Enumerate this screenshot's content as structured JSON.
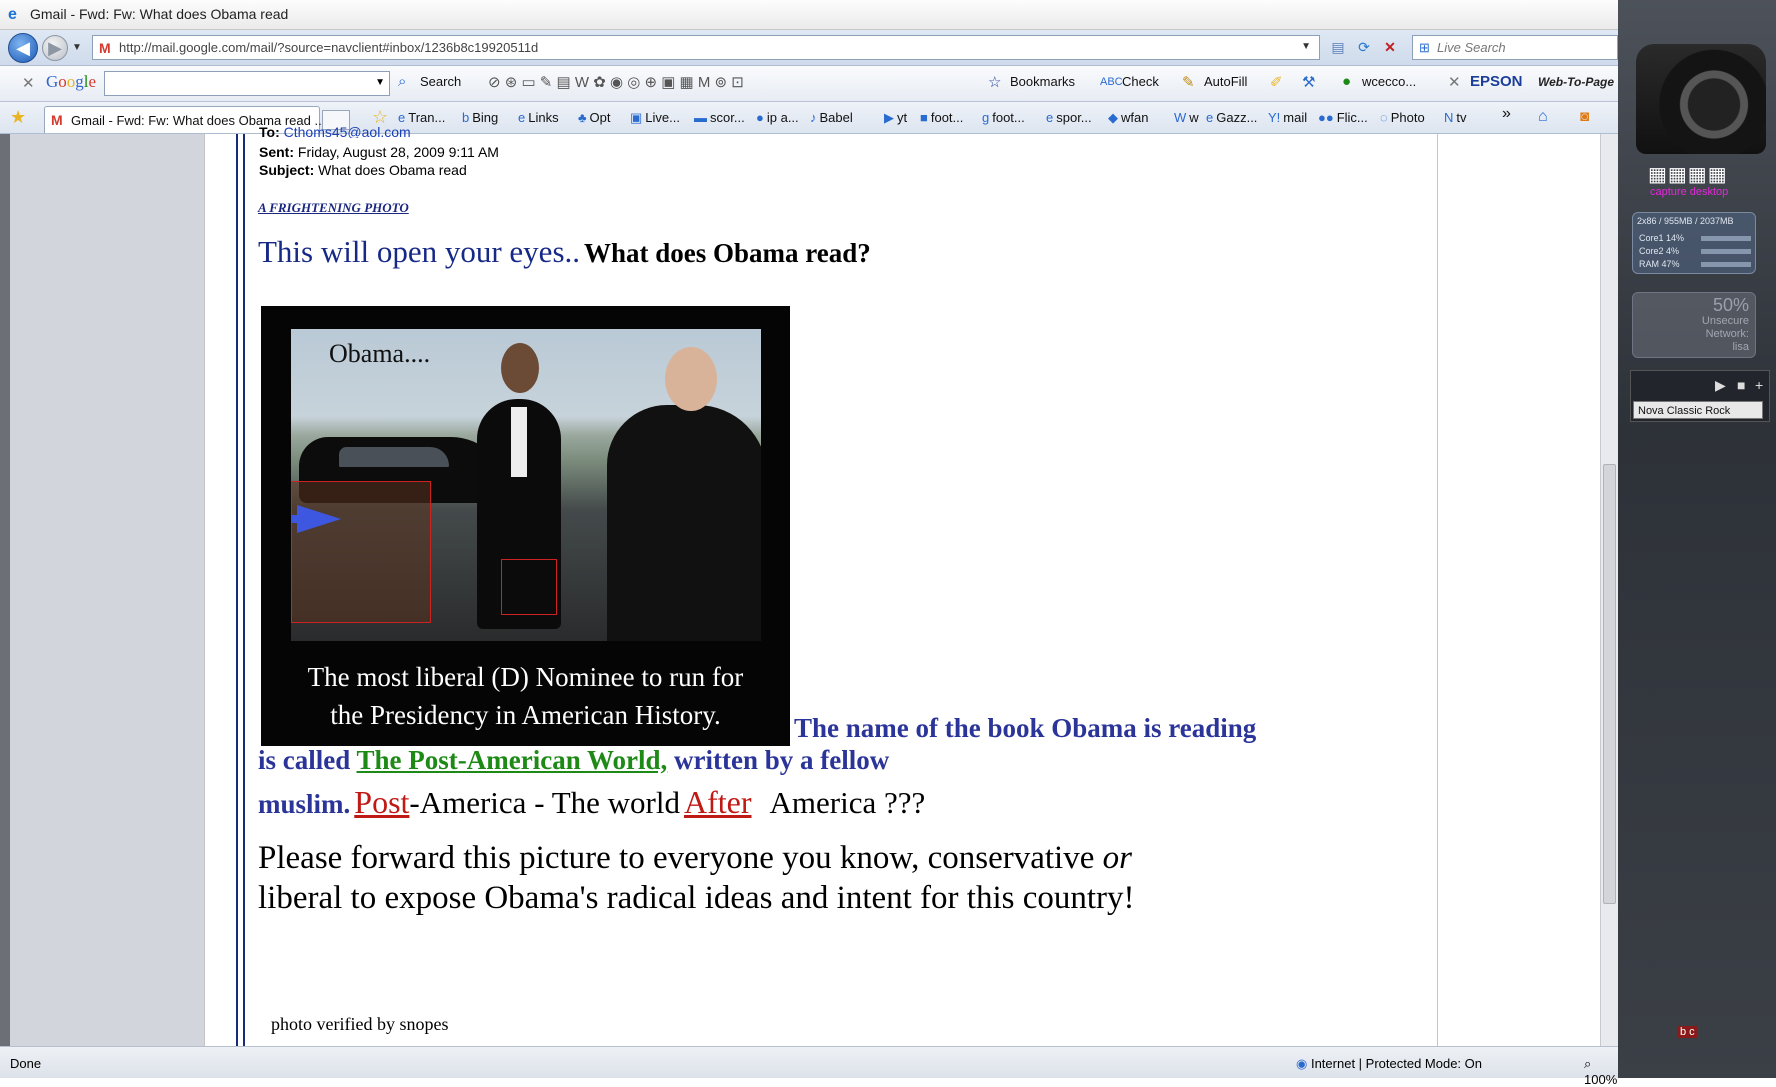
{
  "window": {
    "title": "Gmail - Fwd: Fw: What does Obama read"
  },
  "address_bar": {
    "url": "http://mail.google.com/mail/?source=navclient#inbox/1236b8c19920511d",
    "search_placeholder": "Live Search"
  },
  "google_toolbar": {
    "logo": "Google",
    "search_label": "Search",
    "bookmarks_label": "Bookmarks",
    "check_label": "Check",
    "autofill_label": "AutoFill",
    "wcecco_label": "wcecco...",
    "epson_label": "EPSON",
    "webtopage_label": "Web-To-Page"
  },
  "tab": {
    "label": "Gmail - Fwd: Fw: What does Obama read ..."
  },
  "favorites": [
    {
      "label": "Tran...",
      "icon": "ie-page-icon"
    },
    {
      "label": "Bing",
      "icon": "bing-icon"
    },
    {
      "label": "Links",
      "icon": "ie-page-icon"
    },
    {
      "label": "Opt",
      "icon": "opt-icon"
    },
    {
      "label": "Live...",
      "icon": "live-icon"
    },
    {
      "label": "scor...",
      "icon": "score-icon"
    },
    {
      "label": "ip a...",
      "icon": "ip-icon"
    },
    {
      "label": "Babel",
      "icon": "babel-icon"
    },
    {
      "label": "yt",
      "icon": "youtube-icon"
    },
    {
      "label": "foot...",
      "icon": "bbc-icon"
    },
    {
      "label": "foot...",
      "icon": "foot-icon"
    },
    {
      "label": "spor...",
      "icon": "ie-page-icon"
    },
    {
      "label": "wfan",
      "icon": "wfan-icon"
    },
    {
      "label": "w",
      "icon": "wikipedia-icon"
    },
    {
      "label": "Gazz...",
      "icon": "ie-page-icon"
    },
    {
      "label": "mail",
      "icon": "yahoo-icon"
    },
    {
      "label": "Flic...",
      "icon": "flickr-icon"
    },
    {
      "label": "Photo",
      "icon": "photo-icon"
    },
    {
      "label": "tv",
      "icon": "tv-icon"
    }
  ],
  "email": {
    "to_label": "To:",
    "to_value": "Cthoms45@aol.com",
    "sent_label": "Sent:",
    "sent_value": "Friday, August 28, 2009 9:11 AM",
    "subject_label": "Subject:",
    "subject_value": "What does Obama read",
    "frightening": "A FRIGHTENING PHOTO",
    "headline_part1": "This  will open your eyes..",
    "headline_part2": "What does Obama   read?",
    "image": {
      "caption_top": "Obama....",
      "caption_bottom_1": "The most liberal (D) Nominee to run for",
      "caption_bottom_2": "the Presidency in American History."
    },
    "para1_a": "The  name of the book Obama is reading is  called",
    "book_title": "The  Post-American  World,",
    "para1_b": "written by a fellow",
    "muslim": "muslim.",
    "post": "Post",
    "america_mid": "-America  - The world",
    "after": "After",
    "america_end": "America ???",
    "para2_a": " Please  forward this picture to everyone you know,  conservative",
    "para2_or": "or",
    "para2_b": "liberal  to expose Obama's radical ideas and intent for  this country!",
    "snopes": "photo  verified by snopes"
  },
  "status_bar": {
    "left": "Done",
    "zone": "Internet | Protected Mode: On",
    "zoom": "100%"
  },
  "sidebar": {
    "capture_label": "capture desktop",
    "cpu_title": "2x86 / 955MB / 2037MB",
    "cpu_rows": [
      {
        "label": "Core1",
        "value": "14%"
      },
      {
        "label": "Core2",
        "value": "4%"
      },
      {
        "label": "RAM",
        "value": "47%"
      }
    ],
    "net_percent": "50%",
    "net_line1": "Unsecure",
    "net_line2": "Network:",
    "net_line3": "lisa",
    "radio_station": "Nova Classic Rock",
    "bc_label": "b c"
  }
}
